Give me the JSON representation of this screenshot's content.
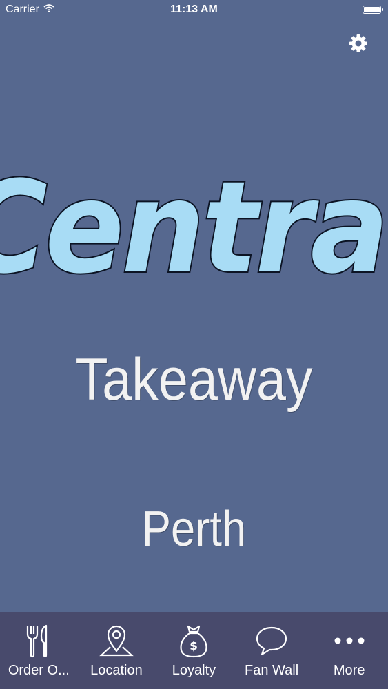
{
  "status_bar": {
    "carrier": "Carrier",
    "time": "11:13 AM"
  },
  "icons": {
    "settings": "gear-icon",
    "wifi": "wifi-icon",
    "battery": "battery-icon"
  },
  "logo": {
    "brand": "Central",
    "fill_color": "#a8dcf5",
    "outline_color": "#0c1424"
  },
  "hero": {
    "line2": "Takeaway",
    "line3": "Perth"
  },
  "colors": {
    "background": "#56688f",
    "tab_bar": "#484a6c",
    "text": "#ffffff"
  },
  "tabs": [
    {
      "label": "Order O...",
      "icon": "fork-knife-icon"
    },
    {
      "label": "Location",
      "icon": "location-pin-icon"
    },
    {
      "label": "Loyalty",
      "icon": "money-bag-icon"
    },
    {
      "label": "Fan Wall",
      "icon": "speech-bubble-icon"
    },
    {
      "label": "More",
      "icon": "more-dots-icon"
    }
  ]
}
